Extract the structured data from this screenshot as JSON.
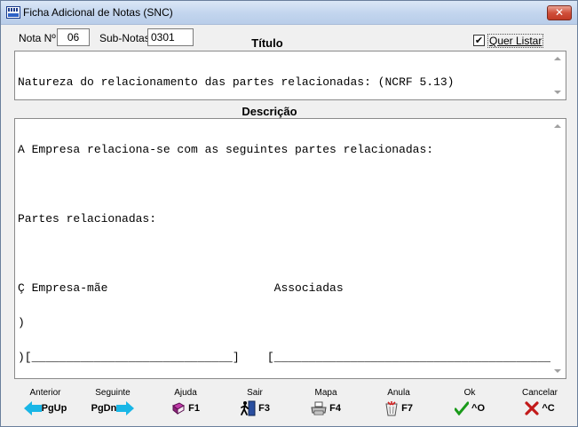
{
  "window": {
    "title": "Ficha Adicional de Notas (SNC)",
    "close_glyph": "✕"
  },
  "header": {
    "nota_label": "Nota Nº",
    "nota_value": "06",
    "subnotas_label": "Sub-Notas",
    "subnotas_value": "0301",
    "titulo_heading": "Título",
    "quer_listar_label": "Quer Listar",
    "quer_listar_checked": true,
    "check_glyph": "✔"
  },
  "titulo": {
    "text": "Natureza do relacionamento das partes relacionadas: (NCRF 5.13)"
  },
  "descricao": {
    "heading": "Descrição",
    "lines": [
      "A Empresa relaciona-se com as seguintes partes relacionadas:",
      "",
      "Partes relacionadas:",
      "",
      "Ç Empresa-mãe                        Associadas",
      ")",
      ")[_____________________________]    [_________________________________________]",
      ")"
    ]
  },
  "buttons": [
    {
      "caption": "Anterior",
      "key": "PgUp",
      "icon": "arrow-left-icon"
    },
    {
      "caption": "Seguinte",
      "key": "PgDn",
      "icon": "arrow-right-icon"
    },
    {
      "caption": "Ajuda",
      "key": "F1",
      "icon": "book-icon"
    },
    {
      "caption": "Sair",
      "key": "F3",
      "icon": "exit-walker-icon"
    },
    {
      "caption": "Mapa",
      "key": "F4",
      "icon": "printer-icon"
    },
    {
      "caption": "Anula",
      "key": "F7",
      "icon": "trash-icon"
    },
    {
      "caption": "Ok",
      "key": "^O",
      "icon": "checkmark-icon"
    },
    {
      "caption": "Cancelar",
      "key": "^C",
      "icon": "cross-icon"
    }
  ],
  "colors": {
    "arrow_accent": "#19b6e6",
    "ok_green": "#1a9a1a",
    "cancel_red": "#c21a1a"
  }
}
